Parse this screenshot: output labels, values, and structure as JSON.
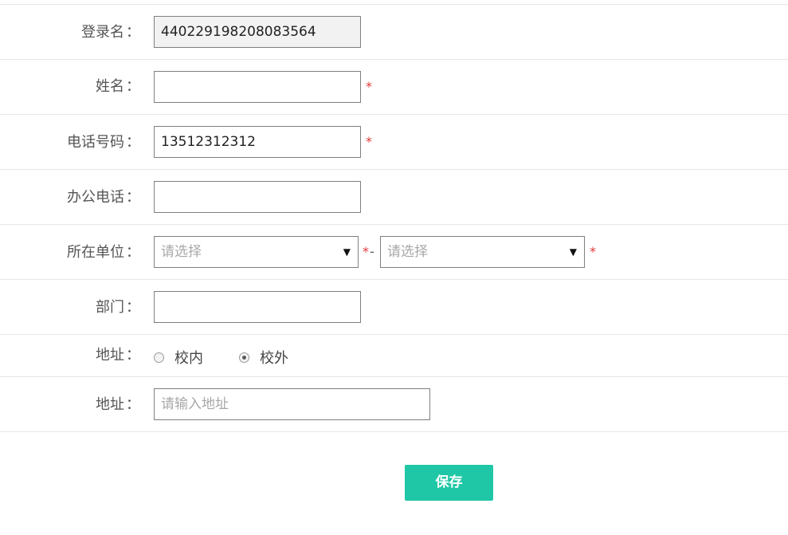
{
  "form": {
    "login_name": {
      "label": "登录名",
      "value": "440229198208083564"
    },
    "name": {
      "label": "姓名",
      "value": "",
      "required": "*"
    },
    "phone": {
      "label": "电话号码",
      "value": "13512312312",
      "required": "*"
    },
    "office_phone": {
      "label": "办公电话",
      "value": ""
    },
    "unit": {
      "label": "所在单位",
      "select1_placeholder": "请选择",
      "select2_placeholder": "请选择",
      "required": "*",
      "separator": "-"
    },
    "department": {
      "label": "部门",
      "value": ""
    },
    "address_type": {
      "label": "地址",
      "options": [
        {
          "label": "校内",
          "checked": false
        },
        {
          "label": "校外",
          "checked": true
        }
      ]
    },
    "address": {
      "label": "地址",
      "placeholder": "请输入地址"
    },
    "colon": "："
  },
  "actions": {
    "save_label": "保存"
  },
  "colors": {
    "accent": "#1fc7a6",
    "required": "#e23a3a"
  }
}
